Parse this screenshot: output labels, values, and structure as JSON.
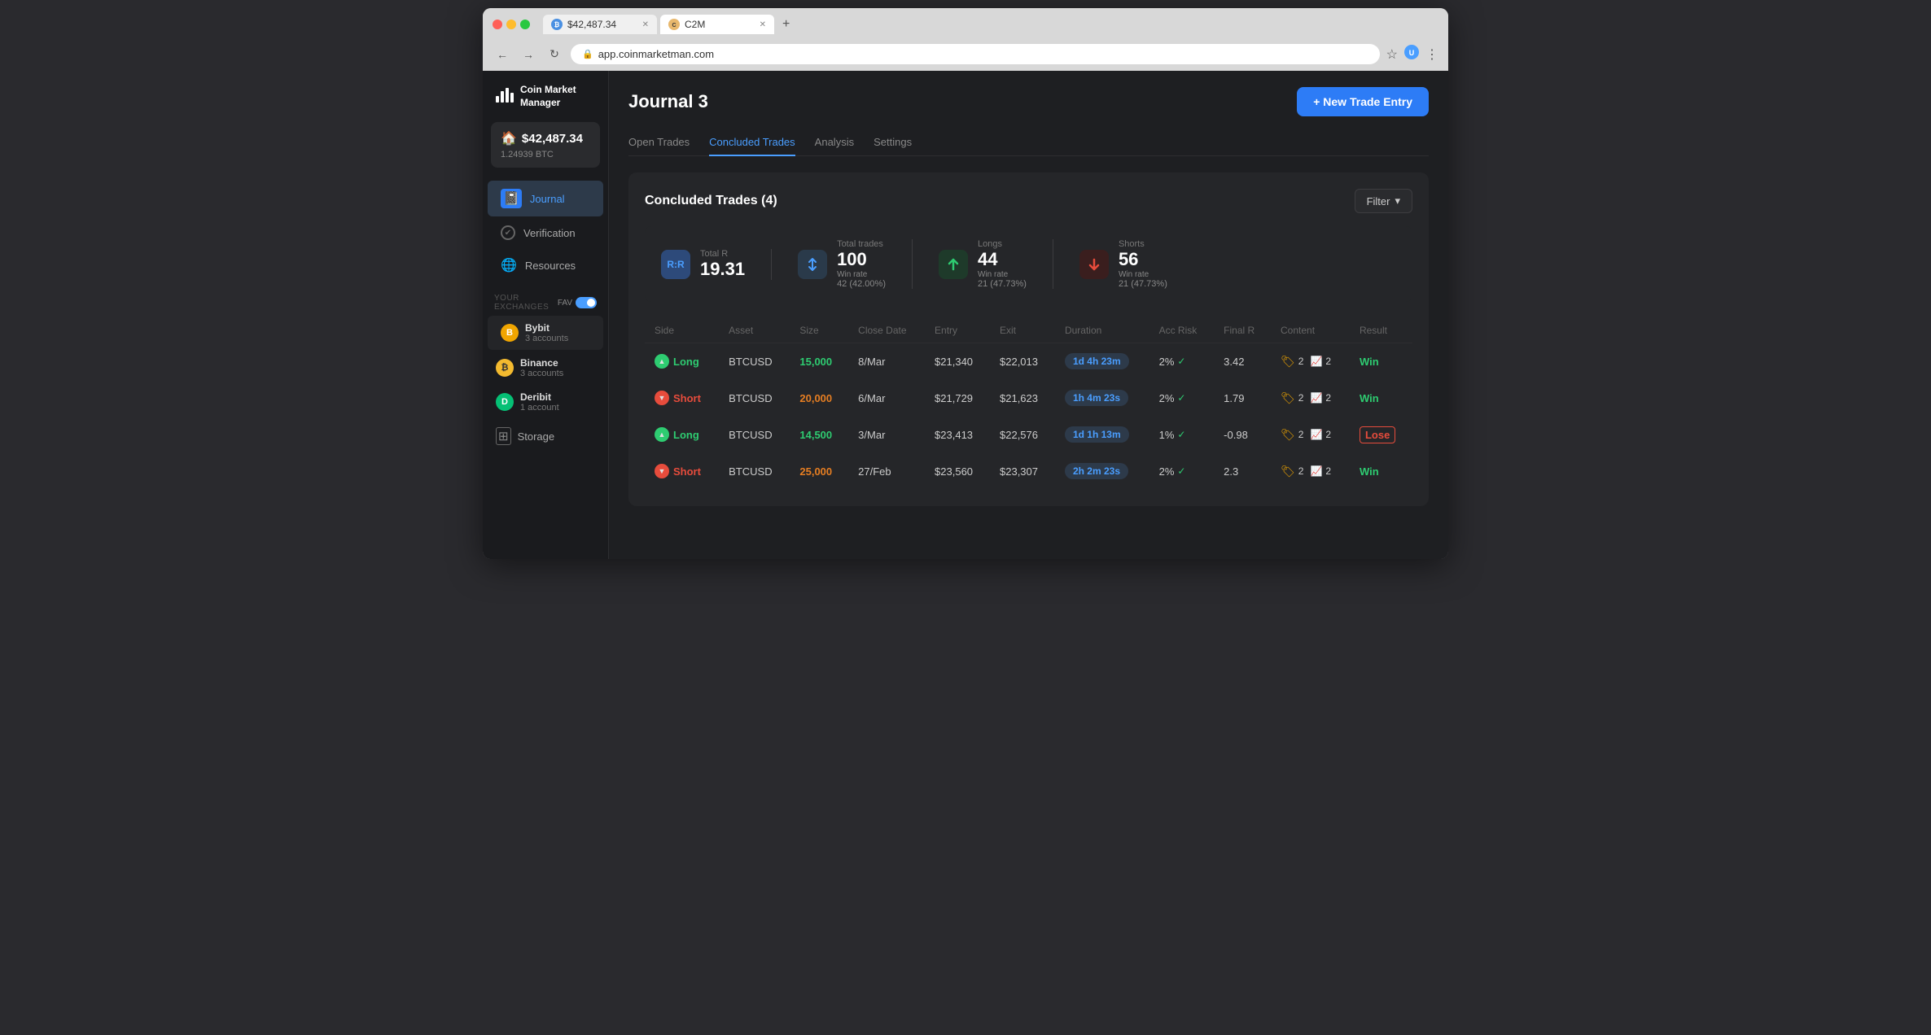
{
  "browser": {
    "tab1": {
      "title": "$42,487.34",
      "icon": "₿",
      "active": false
    },
    "tab2": {
      "title": "C2M",
      "active": true
    },
    "address": "app.coinmarketman.com"
  },
  "sidebar": {
    "logo": {
      "name": "Coin Market\nManager"
    },
    "wallet": {
      "amount": "$42,487.34",
      "btc": "1.24939 BTC"
    },
    "nav": [
      {
        "label": "Journal",
        "active": true,
        "icon": "📓"
      },
      {
        "label": "Verification",
        "active": false,
        "icon": "✔"
      },
      {
        "label": "Resources",
        "active": false,
        "icon": "🌐"
      }
    ],
    "exchanges_label": "YOUR EXCHANGES",
    "fav_label": "FAV",
    "exchanges": [
      {
        "name": "Bybit",
        "accounts": "3 accounts",
        "selected": true
      },
      {
        "name": "Binance",
        "accounts": "3 accounts",
        "selected": false
      },
      {
        "name": "Deribit",
        "accounts": "1 account",
        "selected": false
      }
    ],
    "storage_label": "Storage"
  },
  "main": {
    "page_title": "Journal 3",
    "new_trade_btn": "+ New Trade Entry",
    "tabs": [
      {
        "label": "Open Trades",
        "active": false
      },
      {
        "label": "Concluded Trades",
        "active": true
      },
      {
        "label": "Analysis",
        "active": false
      },
      {
        "label": "Settings",
        "active": false
      }
    ],
    "section_title": "Concluded Trades (4)",
    "filter_btn": "Filter",
    "stats": {
      "rr": {
        "label": "Total R",
        "value": "19.31",
        "icon": "R:R"
      },
      "trades": {
        "label": "Total trades",
        "value": "100",
        "sub": "42 (42.00%)",
        "sub_label": "Win rate"
      },
      "longs": {
        "label": "Longs",
        "value": "44",
        "sub": "21 (47.73%)",
        "sub_label": "Win rate"
      },
      "shorts": {
        "label": "Shorts",
        "value": "56",
        "sub": "21 (47.73%)",
        "sub_label": "Win rate"
      }
    },
    "table_headers": [
      "Side",
      "Asset",
      "Size",
      "Close Date",
      "Entry",
      "Exit",
      "Duration",
      "Acc Risk",
      "Final R",
      "Content",
      "Result"
    ],
    "trades": [
      {
        "side": "Long",
        "side_type": "long",
        "asset": "BTCUSD",
        "size": "15,000",
        "close_date": "8/Mar",
        "entry": "$21,340",
        "exit": "$22,013",
        "duration": "1d 4h 23m",
        "acc_risk": "2%",
        "final_r": "3.42",
        "content_tag": "2",
        "content_chart": "2",
        "result": "Win",
        "result_type": "win"
      },
      {
        "side": "Short",
        "side_type": "short",
        "asset": "BTCUSD",
        "size": "20,000",
        "close_date": "6/Mar",
        "entry": "$21,729",
        "exit": "$21,623",
        "duration": "1h 4m 23s",
        "acc_risk": "2%",
        "final_r": "1.79",
        "content_tag": "2",
        "content_chart": "2",
        "result": "Win",
        "result_type": "win"
      },
      {
        "side": "Long",
        "side_type": "long",
        "asset": "BTCUSD",
        "size": "14,500",
        "close_date": "3/Mar",
        "entry": "$23,413",
        "exit": "$22,576",
        "duration": "1d 1h 13m",
        "acc_risk": "1%",
        "final_r": "-0.98",
        "content_tag": "2",
        "content_chart": "2",
        "result": "Lose",
        "result_type": "lose"
      },
      {
        "side": "Short",
        "side_type": "short",
        "asset": "BTCUSD",
        "size": "25,000",
        "close_date": "27/Feb",
        "entry": "$23,560",
        "exit": "$23,307",
        "duration": "2h 2m 23s",
        "acc_risk": "2%",
        "final_r": "2.3",
        "content_tag": "2",
        "content_chart": "2",
        "result": "Win",
        "result_type": "win"
      }
    ]
  }
}
